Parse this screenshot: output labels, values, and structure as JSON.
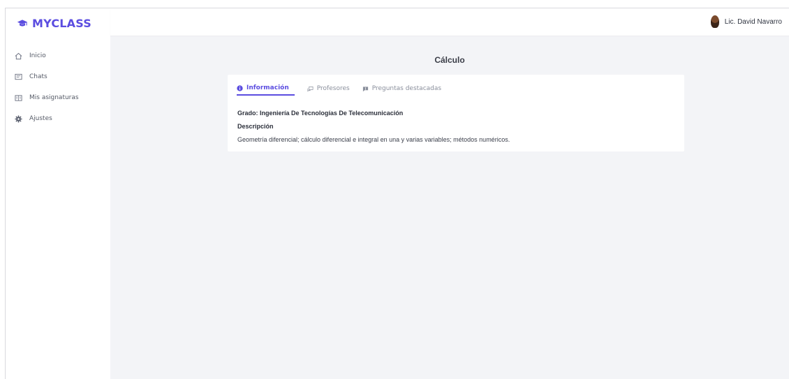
{
  "app": {
    "brand": "MYCLASS",
    "accent": "#5b4de0"
  },
  "user": {
    "name": "Lic. David Navarro"
  },
  "sidebar": {
    "items": [
      {
        "label": "Inicio",
        "icon": "home-icon"
      },
      {
        "label": "Chats",
        "icon": "chat-icon"
      },
      {
        "label": "Mis asignaturas",
        "icon": "subjects-icon"
      },
      {
        "label": "Ajustes",
        "icon": "gear-icon"
      }
    ]
  },
  "main": {
    "title": "Cálculo",
    "tabs": [
      {
        "label": "Información",
        "icon": "info-icon",
        "active": true
      },
      {
        "label": "Profesores",
        "icon": "chat-bubbles-icon",
        "active": false
      },
      {
        "label": "Preguntas destacadas",
        "icon": "message-icon",
        "active": false
      }
    ],
    "grado": "Grado: Ingeniería De Tecnologías De Telecomunicación",
    "descripcion_title": "Descripción",
    "descripcion": "Geometría diferencial; cálculo diferencial e integral en una y varias variables; métodos numéricos."
  }
}
